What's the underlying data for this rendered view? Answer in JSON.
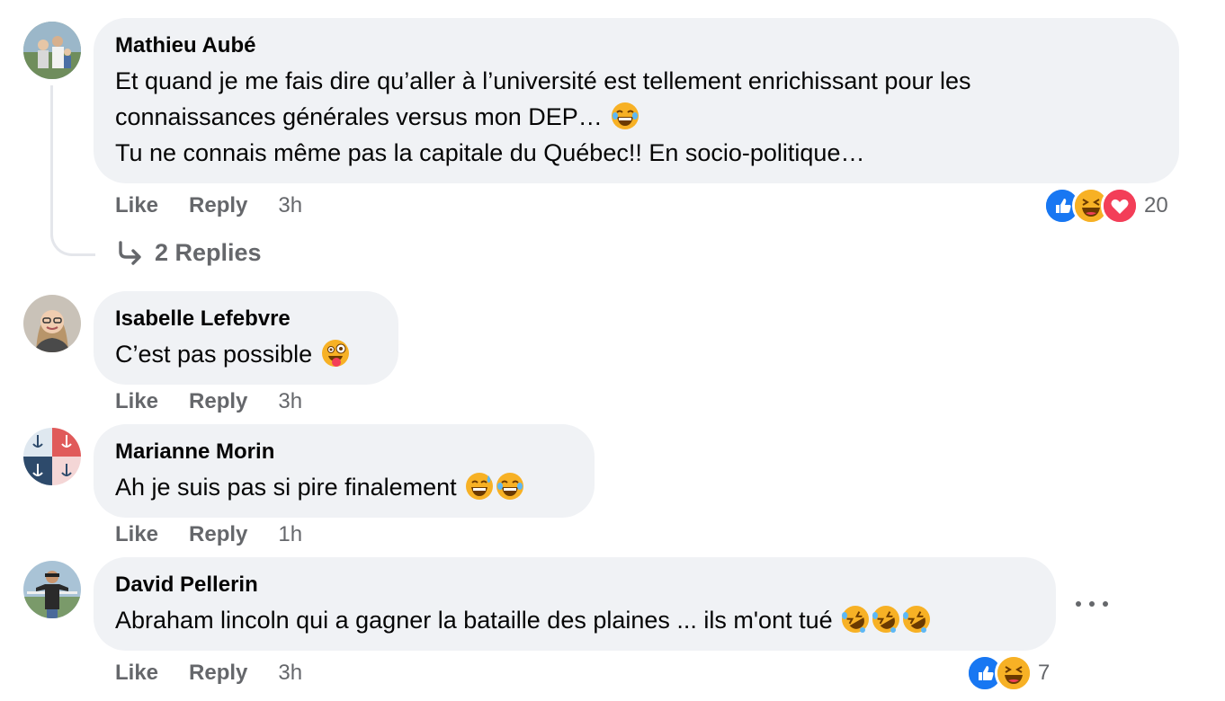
{
  "colors": {
    "bubble": "#f0f2f5",
    "meta": "#65676b",
    "like_blue": "#1877f2",
    "love_red": "#f33e58",
    "haha_yellow": "#f7b125"
  },
  "comments": [
    {
      "author": "Mathieu Aubé",
      "lines": [
        "Et quand je me fais dire qu’aller à l’université est tellement enrichissant pour les",
        "connaissances générales versus mon DEP… ",
        "Tu ne connais même pas la capitale du Québec!! En socio-politique…"
      ],
      "emojis": [
        "joy-emoji"
      ],
      "actions": {
        "like": "Like",
        "reply": "Reply",
        "time": "3h"
      },
      "reactions": {
        "icons": [
          "like-reaction-icon",
          "haha-reaction-icon",
          "love-reaction-icon"
        ],
        "count": "20"
      },
      "replies_label": "2 Replies"
    },
    {
      "author": "Isabelle Lefebvre",
      "text": "C’est pas possible ",
      "emojis": [
        "zany-tongue-emoji"
      ],
      "actions": {
        "like": "Like",
        "reply": "Reply",
        "time": "3h"
      }
    },
    {
      "author": "Marianne Morin",
      "text": "Ah je suis pas si pire finalement ",
      "emojis": [
        "sweat-smile-emoji",
        "joy-emoji"
      ],
      "actions": {
        "like": "Like",
        "reply": "Reply",
        "time": "1h"
      }
    },
    {
      "author": "David Pellerin",
      "text": "Abraham lincoln qui a gagner la bataille des plaines ... ils m'ont tué ",
      "emojis": [
        "rofl-emoji",
        "rofl-emoji",
        "rofl-emoji"
      ],
      "actions": {
        "like": "Like",
        "reply": "Reply",
        "time": "3h"
      },
      "reactions": {
        "icons": [
          "like-reaction-icon",
          "haha-reaction-icon"
        ],
        "count": "7"
      }
    }
  ]
}
